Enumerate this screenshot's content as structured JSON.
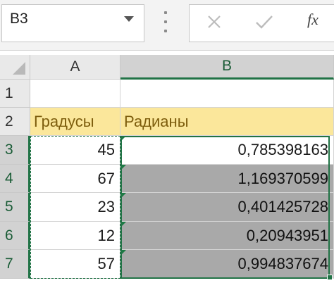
{
  "formula_bar": {
    "name_box": "B3",
    "fx_label": "fx"
  },
  "columns": [
    "A",
    "B"
  ],
  "rows": [
    "1",
    "2",
    "3",
    "4",
    "5",
    "6",
    "7"
  ],
  "cells": {
    "A2": "Градусы",
    "B2": "Радианы",
    "A3": "45",
    "B3": "0,785398163",
    "A4": "67",
    "B4": "1,169370599",
    "A5": "23",
    "B5": "0,401425728",
    "A6": "12",
    "B6": "0,20943951",
    "A7": "57",
    "B7": "0,994837674"
  },
  "colors": {
    "accent": "#217346",
    "header_fill": "#fbe79b",
    "header_text": "#7d5d0d",
    "selected_fill": "#a9a9a9"
  },
  "icons": [
    "dropdown-arrow-icon",
    "cancel-icon",
    "enter-icon",
    "function-icon"
  ]
}
